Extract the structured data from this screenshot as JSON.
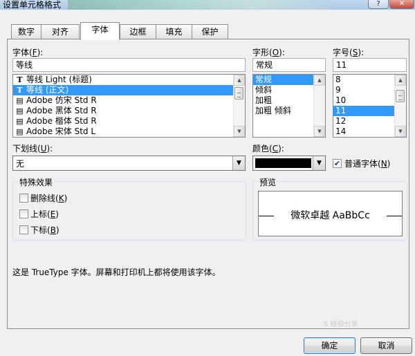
{
  "window": {
    "title": "设置单元格格式",
    "help_glyph": "?",
    "close_glyph": "✕"
  },
  "tabs": [
    {
      "label": "数字",
      "active": false
    },
    {
      "label": "对齐",
      "active": false
    },
    {
      "label": "字体",
      "active": true
    },
    {
      "label": "边框",
      "active": false
    },
    {
      "label": "填充",
      "active": false
    },
    {
      "label": "保护",
      "active": false
    }
  ],
  "font": {
    "label": "字体(",
    "label_key": "F",
    "label_end": "):",
    "value": "等线",
    "items": [
      {
        "icon": "T",
        "icon_name": "truetype-font-icon",
        "label": "等线 Light (标题)",
        "selected": false
      },
      {
        "icon": "T",
        "icon_name": "truetype-font-icon",
        "label": "等线 (正文)",
        "selected": true
      },
      {
        "icon": "▤",
        "icon_name": "opentype-font-icon",
        "label": "Adobe 仿宋 Std R",
        "selected": false
      },
      {
        "icon": "▤",
        "icon_name": "opentype-font-icon",
        "label": "Adobe 黑体 Std R",
        "selected": false
      },
      {
        "icon": "▤",
        "icon_name": "opentype-font-icon",
        "label": "Adobe 楷体 Std R",
        "selected": false
      },
      {
        "icon": "▤",
        "icon_name": "opentype-font-icon",
        "label": "Adobe 宋体 Std L",
        "selected": false
      }
    ]
  },
  "style": {
    "label": "字形(",
    "label_key": "O",
    "label_end": "):",
    "value": "常规",
    "items": [
      {
        "label": "常规",
        "selected": true
      },
      {
        "label": "倾斜",
        "selected": false
      },
      {
        "label": "加粗",
        "selected": false
      },
      {
        "label": "加粗 倾斜",
        "selected": false
      }
    ]
  },
  "size": {
    "label": "字号(",
    "label_key": "S",
    "label_end": "):",
    "value": "11",
    "items": [
      {
        "label": "8",
        "selected": false
      },
      {
        "label": "9",
        "selected": false
      },
      {
        "label": "10",
        "selected": false
      },
      {
        "label": "11",
        "selected": true
      },
      {
        "label": "12",
        "selected": false
      },
      {
        "label": "14",
        "selected": false
      }
    ]
  },
  "underline": {
    "label": "下划线(",
    "label_key": "U",
    "label_end": "):",
    "value": "无"
  },
  "color": {
    "label": "颜色(",
    "label_key": "C",
    "label_end": "):",
    "value_hex": "#000000"
  },
  "normal_font": {
    "label": "普通字体(",
    "label_key": "N",
    "label_end": ")",
    "checked": true
  },
  "effects": {
    "title": "特殊效果",
    "strikethrough": {
      "label": "删除线(",
      "label_key": "K",
      "label_end": ")",
      "checked": false
    },
    "superscript": {
      "label": "上标(",
      "label_key": "E",
      "label_end": ")",
      "checked": false
    },
    "subscript": {
      "label": "下标(",
      "label_key": "B",
      "label_end": ")",
      "checked": false
    }
  },
  "preview": {
    "title": "预览",
    "text": "微软卓越 AaBbCc"
  },
  "description": "这是 TrueType 字体。屏幕和打印机上都将使用该字体。",
  "buttons": {
    "ok": "确定",
    "cancel": "取消"
  },
  "watermark": "S 经验分享",
  "colors": {
    "selection": "#3399ff",
    "dialog_bg": "#f0f0f0"
  }
}
